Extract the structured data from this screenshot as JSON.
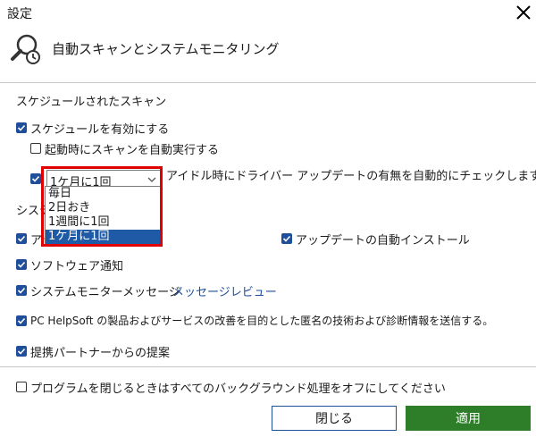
{
  "window": {
    "title": "設定"
  },
  "header": {
    "title": "自動スキャンとシステムモニタリング"
  },
  "schedule": {
    "section_title": "スケジュールされたスキャン",
    "enable_label": "スケジュールを有効にする",
    "startup_label": "起動時にスキャンを自動実行する",
    "driver_check_label": "アイドル時にドライバー アップデートの有無を自動的にチェックします",
    "frequency_value": "1ケ月に1回",
    "frequency_options": [
      "毎日",
      "2日おき",
      "1週間に1回",
      "1ケ月に1回"
    ],
    "selected_index": 3
  },
  "system": {
    "section_title_partial": "システ",
    "hidden_item_partial": "アッ",
    "auto_install_label": "アップデートの自動インストール",
    "software_notice_label": "ソフトウェア通知",
    "monitor_message_label": "システムモニターメッセージ",
    "message_review_link": "メッセージレビュー",
    "improvement_label": "PC HelpSoft の製品およびサービスの改善を目的とした匿名の技術および診断情報を送信する。",
    "partner_label": "提携パートナーからの提案"
  },
  "footer": {
    "background_off_label": "プログラムを閉じるときはすべてのバックグラウンド処理をオフにしてください",
    "close_button": "閉じる",
    "apply_button": "適用"
  },
  "colors": {
    "accent": "#1f4e9a",
    "apply": "#2e7d28",
    "highlight": "#e00000",
    "selection": "#1f5aa6"
  }
}
